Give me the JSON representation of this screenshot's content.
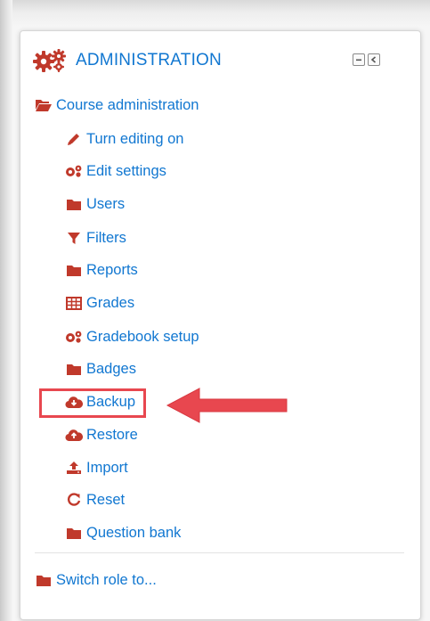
{
  "header": {
    "title": "ADMINISTRATION",
    "icon": "gears-icon",
    "controls": [
      "minimize-icon",
      "dock-icon"
    ]
  },
  "colors": {
    "link": "#1177d1",
    "icon": "#c0392b",
    "highlight": "#e8474f"
  },
  "course_admin": {
    "label": "Course administration",
    "icon": "folder-open-icon"
  },
  "items": [
    {
      "label": "Turn editing on",
      "icon": "pencil-icon"
    },
    {
      "label": "Edit settings",
      "icon": "gears-icon"
    },
    {
      "label": "Users",
      "icon": "folder-icon"
    },
    {
      "label": "Filters",
      "icon": "filter-icon"
    },
    {
      "label": "Reports",
      "icon": "folder-icon"
    },
    {
      "label": "Grades",
      "icon": "table-icon"
    },
    {
      "label": "Gradebook setup",
      "icon": "gears-icon"
    },
    {
      "label": "Badges",
      "icon": "folder-icon"
    },
    {
      "label": "Backup",
      "icon": "cloud-download-icon"
    },
    {
      "label": "Restore",
      "icon": "cloud-upload-icon"
    },
    {
      "label": "Import",
      "icon": "upload-icon"
    },
    {
      "label": "Reset",
      "icon": "refresh-icon"
    },
    {
      "label": "Question bank",
      "icon": "folder-icon"
    }
  ],
  "switch_role": {
    "label": "Switch role to...",
    "icon": "folder-icon"
  }
}
